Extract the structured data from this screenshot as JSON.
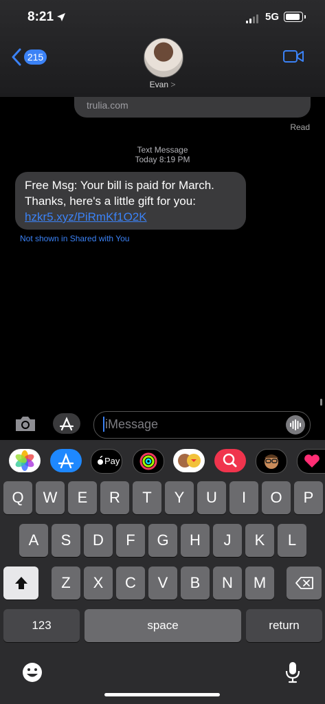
{
  "status_bar": {
    "time": "8:21",
    "network": "5G"
  },
  "header": {
    "back_count": "215",
    "contact_name": "Evan",
    "contact_chevron": ">"
  },
  "conversation": {
    "previous_snippet": "trulia.com",
    "read_receipt": "Read",
    "message_type": "Text Message",
    "timestamp": "Today 8:19 PM",
    "message": {
      "line1": "Free Msg: Your bill is paid for March.",
      "line2": "Thanks, here's a little gift for you:",
      "link": "hzkr5.xyz/PiRmKf1O2K"
    },
    "shared_note": "Not shown in Shared with You"
  },
  "composer": {
    "placeholder": "iMessage"
  },
  "app_drawer": {
    "apps": [
      "photos-icon",
      "app-store-icon",
      "apple-pay-icon",
      "activity-icon",
      "memoji-stickers-icon",
      "images-search-icon",
      "memoji-icon",
      "digital-touch-icon"
    ],
    "apple_pay_label": "Pay"
  },
  "keyboard": {
    "row1": [
      "Q",
      "W",
      "E",
      "R",
      "T",
      "Y",
      "U",
      "I",
      "O",
      "P"
    ],
    "row2": [
      "A",
      "S",
      "D",
      "F",
      "G",
      "H",
      "J",
      "K",
      "L"
    ],
    "row3": [
      "Z",
      "X",
      "C",
      "V",
      "B",
      "N",
      "M"
    ],
    "numbers_label": "123",
    "space_label": "space",
    "return_label": "return"
  },
  "colors": {
    "accent": "#3b82f6",
    "bubble": "#3a3a3c",
    "keyboard_bg": "#2c2c2e"
  }
}
